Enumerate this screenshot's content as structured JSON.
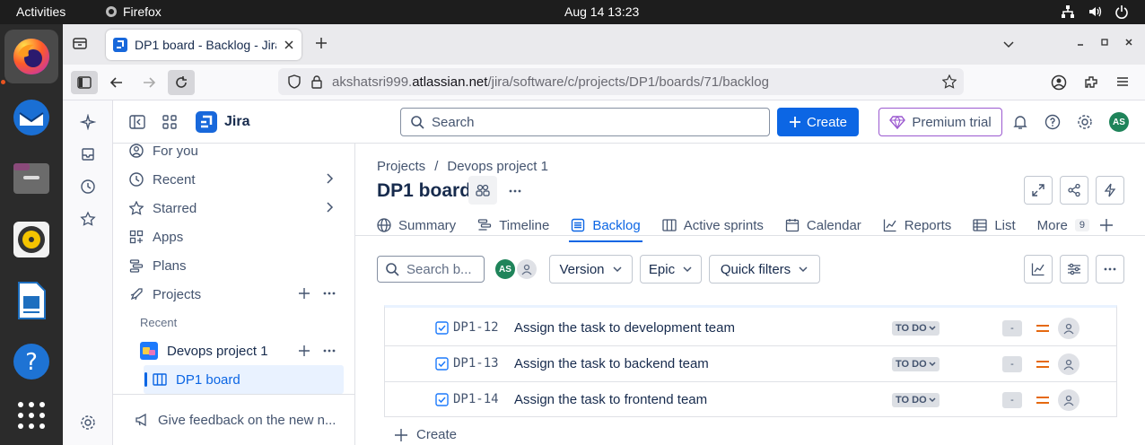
{
  "os": {
    "activities": "Activities",
    "app_name": "Firefox",
    "clock": "Aug 14  13:23"
  },
  "browser": {
    "tab_title": "DP1 board - Backlog - Jira",
    "url_prefix": "akshatsri999.",
    "url_host": "atlassian.net",
    "url_path": "/jira/software/c/projects/DP1/boards/71/backlog"
  },
  "header": {
    "product": "Jira",
    "search_placeholder": "Search",
    "create_label": "Create",
    "premium_label": "Premium trial",
    "user_initials": "AS"
  },
  "sidebar": {
    "items": [
      {
        "label": "For you"
      },
      {
        "label": "Recent"
      },
      {
        "label": "Starred"
      },
      {
        "label": "Apps"
      },
      {
        "label": "Plans"
      },
      {
        "label": "Projects"
      }
    ],
    "recent_heading": "Recent",
    "project_name": "Devops project 1",
    "board_name": "DP1 board",
    "feedback": "Give feedback on the new n..."
  },
  "page": {
    "breadcrumb_root": "Projects",
    "breadcrumb_sep": "/",
    "breadcrumb_project": "Devops project 1",
    "title": "DP1 board",
    "tabs": [
      {
        "label": "Summary"
      },
      {
        "label": "Timeline"
      },
      {
        "label": "Backlog"
      },
      {
        "label": "Active sprints"
      },
      {
        "label": "Calendar"
      },
      {
        "label": "Reports"
      },
      {
        "label": "List"
      },
      {
        "label": "More"
      }
    ],
    "more_count": "9"
  },
  "filters": {
    "search_placeholder": "Search b...",
    "avatar_initials": "AS",
    "version_label": "Version",
    "epic_label": "Epic",
    "quick_filters_label": "Quick filters"
  },
  "issues": [
    {
      "key": "DP1-12",
      "summary": "Assign the task to development team",
      "status": "TO DO",
      "estimate": "-"
    },
    {
      "key": "DP1-13",
      "summary": "Assign the task to backend team",
      "status": "TO DO",
      "estimate": "-"
    },
    {
      "key": "DP1-14",
      "summary": "Assign the task to frontend team",
      "status": "TO DO",
      "estimate": "-"
    }
  ],
  "create_issue_label": "Create",
  "colors": {
    "brand_blue": "#0c66e4",
    "premium_purple": "#9b59d0",
    "priority_orange": "#e56910",
    "avatar_green": "#1f845a"
  }
}
